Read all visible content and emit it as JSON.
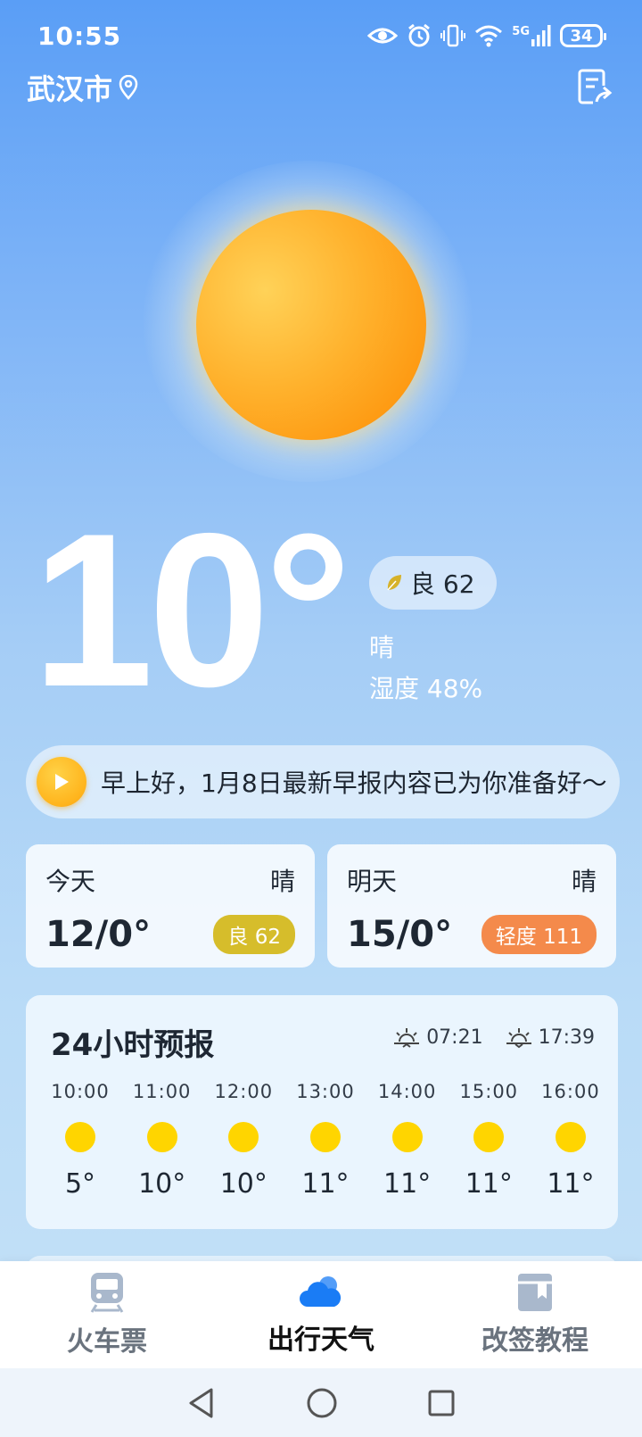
{
  "status_bar": {
    "time": "10:55",
    "network": "5G",
    "battery": "34"
  },
  "header": {
    "city": "武汉市"
  },
  "current": {
    "temperature": "10°",
    "aqi_label": "良 62",
    "condition": "晴",
    "humidity": "湿度 48%"
  },
  "broadcast": {
    "text": "早上好，1月8日最新早报内容已为你准备好～"
  },
  "days": [
    {
      "name": "今天",
      "condition": "晴",
      "range": "12/0°",
      "aqi": "良 62",
      "aqi_color": "#d6bd2b"
    },
    {
      "name": "明天",
      "condition": "晴",
      "range": "15/0°",
      "aqi": "轻度 111",
      "aqi_color": "#f48a4b"
    }
  ],
  "forecast": {
    "title": "24小时预报",
    "sunrise": "07:21",
    "sunset": "17:39",
    "hours": [
      {
        "time": "10:00",
        "icon": "sun-icon",
        "temp": "5°"
      },
      {
        "time": "11:00",
        "icon": "sun-icon",
        "temp": "10°"
      },
      {
        "time": "12:00",
        "icon": "sun-icon",
        "temp": "10°"
      },
      {
        "time": "13:00",
        "icon": "sun-icon",
        "temp": "11°"
      },
      {
        "time": "14:00",
        "icon": "sun-icon",
        "temp": "11°"
      },
      {
        "time": "15:00",
        "icon": "sun-icon",
        "temp": "11°"
      },
      {
        "time": "16:00",
        "icon": "sun-icon",
        "temp": "11°"
      }
    ]
  },
  "tabs": [
    {
      "label": "火车票",
      "icon": "train-icon",
      "active": false
    },
    {
      "label": "出行天气",
      "icon": "cloud-icon",
      "active": true
    },
    {
      "label": "改签教程",
      "icon": "book-icon",
      "active": false
    }
  ],
  "colors": {
    "accent_sun": "#fe9911",
    "active_tab_icon": "#1a7cf5",
    "inactive_tab_icon": "#a9b8cc"
  }
}
